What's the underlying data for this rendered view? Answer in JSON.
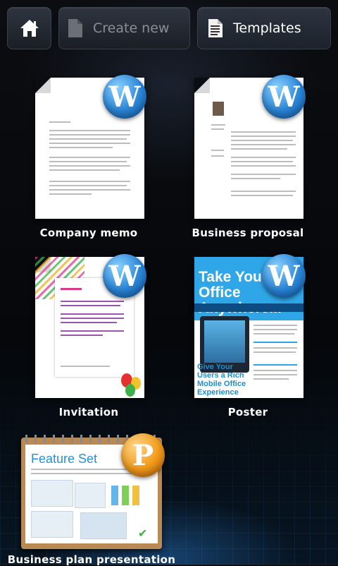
{
  "toolbar": {
    "home_icon": "home-icon",
    "create_new_label": "Create new",
    "templates_label": "Templates"
  },
  "templates": [
    {
      "label": "Company memo",
      "type": "W",
      "app": "word"
    },
    {
      "label": "Business proposal",
      "type": "W",
      "app": "word"
    },
    {
      "label": "Invitation",
      "type": "W",
      "app": "word"
    },
    {
      "label": "Poster",
      "type": "W",
      "app": "word",
      "headline": "Take Your Office Anywhere...",
      "subline": "Give Your Users a Rich Mobile Office Experience"
    },
    {
      "label": "Business plan presentation",
      "type": "P",
      "app": "powerpoint",
      "slide_title": "Feature Set"
    }
  ],
  "colors": {
    "word_badge": "#2a85d6",
    "powerpoint_badge": "#f19a1a",
    "accent_blue": "#2fa6e8"
  }
}
